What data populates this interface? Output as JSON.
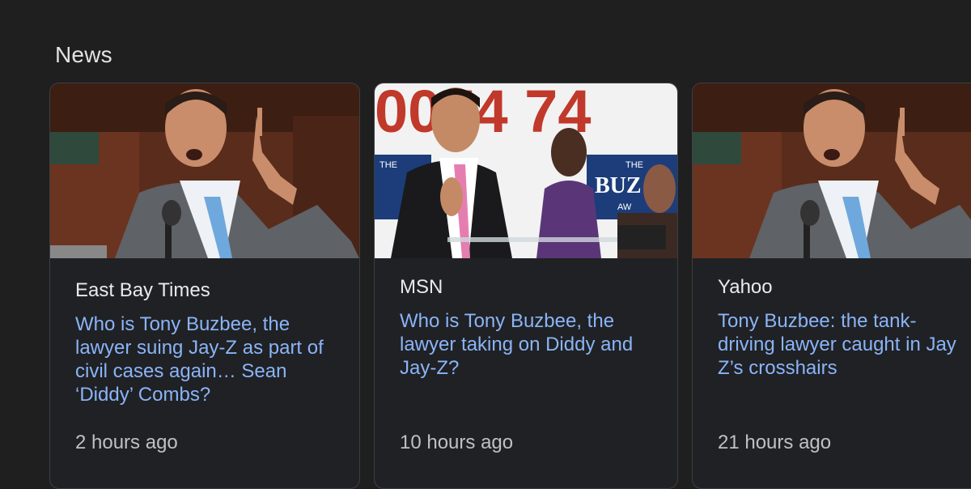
{
  "section": {
    "title": "News"
  },
  "cards": [
    {
      "source": "East Bay Times",
      "headline": "Who is Tony Buzbee, the lawyer suing Jay-Z as part of civil cases again… Sean ‘Diddy’ Combs?",
      "time": "2 hours ago",
      "image": "photo-man-speaking-finger-raised"
    },
    {
      "source": "MSN",
      "headline": "Who is Tony Buzbee, the lawyer taking on Diddy and Jay-Z?",
      "time": "10 hours ago",
      "image": "photo-press-conference",
      "image_text": {
        "banner": "0074 74",
        "sign_left": "THE",
        "sign_right": "BUZ",
        "sign_right_sub": "THE",
        "sign_right_law": "AW"
      }
    },
    {
      "source": "Yahoo",
      "headline": "Tony Buzbee: the tank-driving lawyer caught in Jay Z’s crosshairs",
      "time": "21 hours ago",
      "image": "photo-man-speaking-finger-raised"
    }
  ],
  "colors": {
    "background": "#1f1f1f",
    "card_bg": "#202124",
    "card_border": "#3c4043",
    "headline": "#8ab4f8",
    "source": "#e8eaed",
    "time": "#bdc1c6"
  }
}
